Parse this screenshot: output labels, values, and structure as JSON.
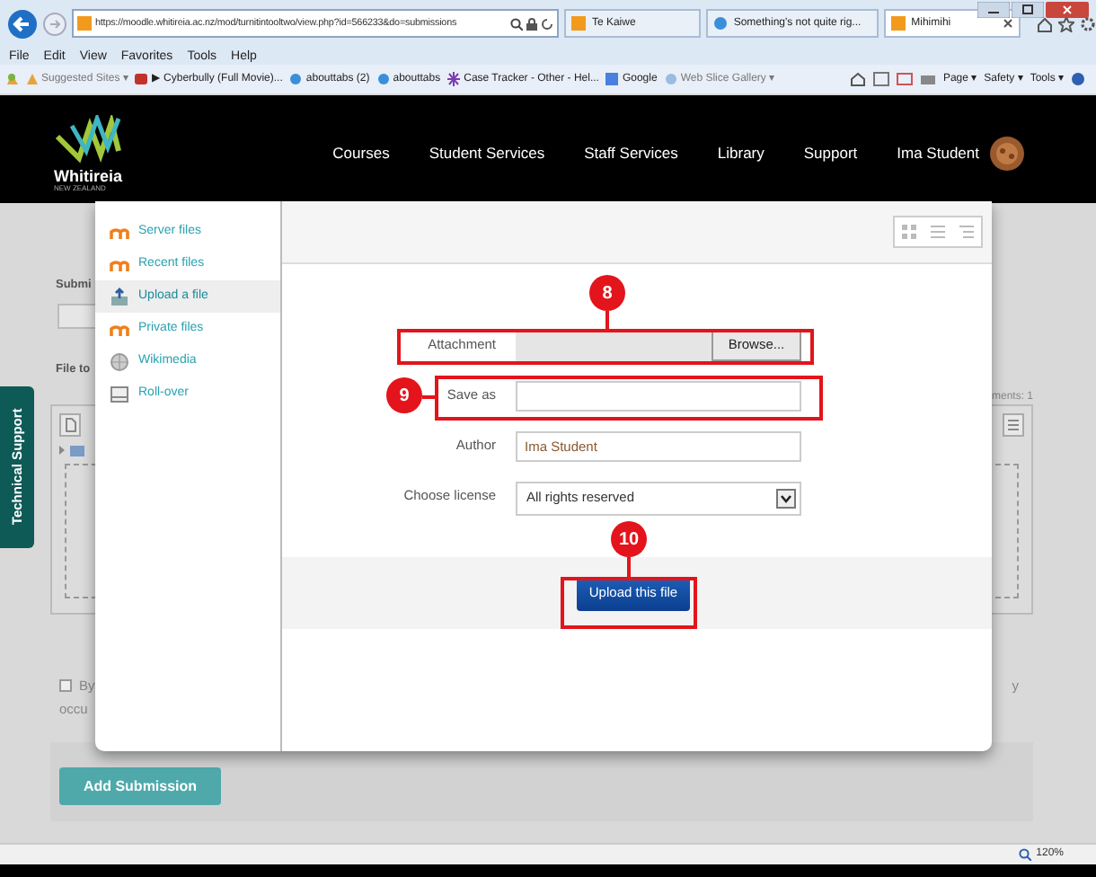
{
  "browser": {
    "address": "https://moodle.whitireia.ac.nz/mod/turnitintooltwo/view.php?id=566233&do=submissions",
    "tabs": [
      {
        "label": "Te Kaiwe",
        "selected": false
      },
      {
        "label": "Something's not quite rig...",
        "selected": false
      },
      {
        "label": "Mihimihi",
        "selected": true
      }
    ],
    "menu": [
      "File",
      "Edit",
      "View",
      "Favorites",
      "Tools",
      "Help"
    ],
    "favorites": [
      "Suggested Sites ▾",
      "▶ Cyberbully (Full Movie)...",
      "abouttabs (2)",
      "abouttabs",
      "Case Tracker - Other - Hel...",
      "Google",
      "Web Slice Gallery ▾"
    ],
    "command_bar": [
      "Page ▾",
      "Safety ▾",
      "Tools ▾"
    ],
    "zoom": "120%"
  },
  "site_header": {
    "logo": {
      "name": "Whitireia",
      "tagline": "NEW ZEALAND"
    },
    "nav": [
      "Courses",
      "Student Services",
      "Staff Services",
      "Library",
      "Support"
    ],
    "user": "Ima Student"
  },
  "page": {
    "side_tab": "Technical Support",
    "submission_label": "Submi",
    "file_label": "File to",
    "comments": "ments: 1",
    "agreement": [
      "By",
      "occu"
    ],
    "agreement_checked": false,
    "agreement_end": "y",
    "add_button": "Add Submission"
  },
  "file_picker": {
    "repositories": [
      {
        "label": "Server files",
        "selected": false
      },
      {
        "label": "Recent files",
        "selected": false
      },
      {
        "label": "Upload a file",
        "selected": true
      },
      {
        "label": "Private files",
        "selected": false
      },
      {
        "label": "Wikimedia",
        "selected": false
      },
      {
        "label": "Roll-over",
        "selected": false
      }
    ],
    "attachment_label": "Attachment",
    "browse": "Browse...",
    "save_as_label": "Save as",
    "author_label": "Author",
    "author": "Ima Student",
    "license_label": "Choose license",
    "license": "All rights reserved",
    "upload_button": "Upload this file",
    "callouts": [
      "8",
      "9",
      "10"
    ]
  }
}
